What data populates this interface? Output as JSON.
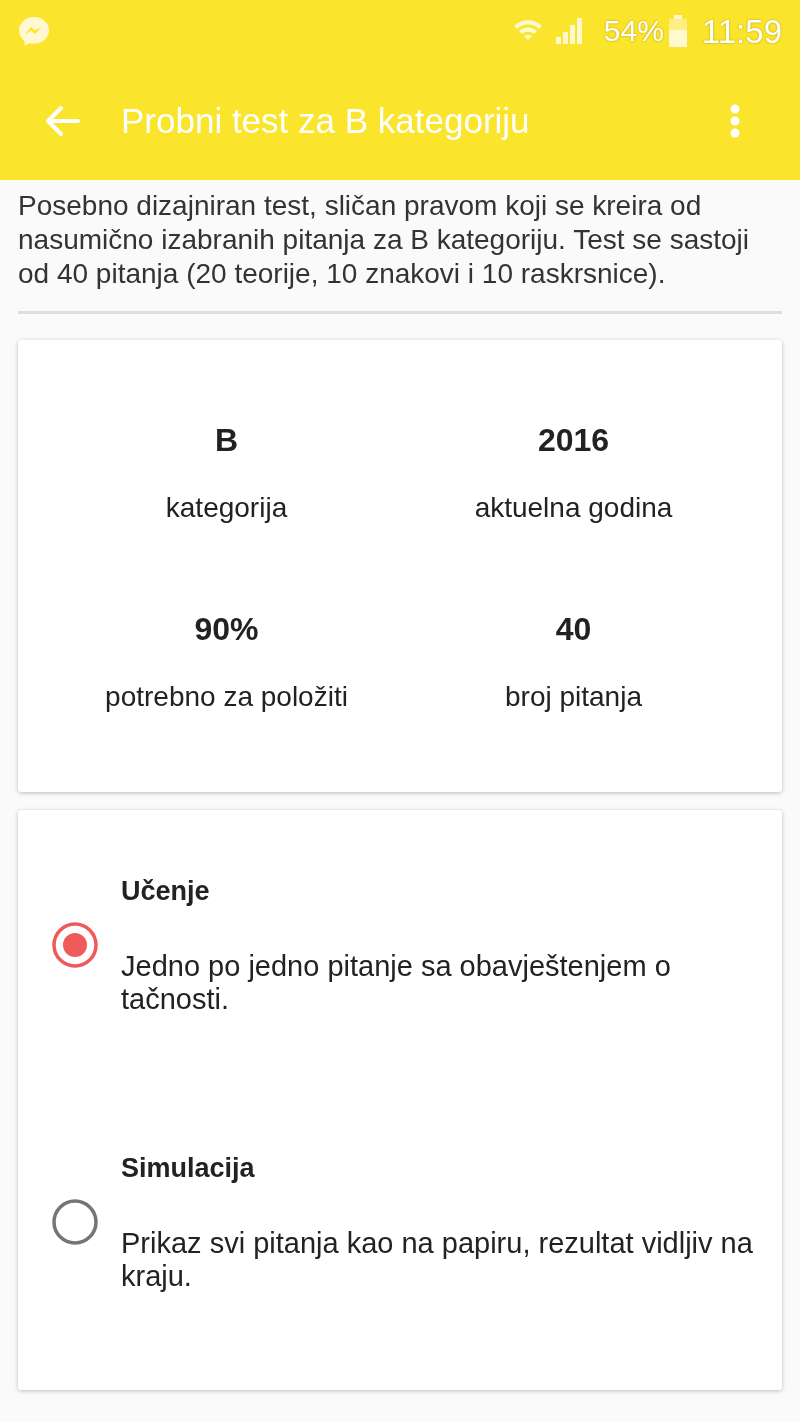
{
  "status_bar": {
    "battery": "54%",
    "time": "11:59"
  },
  "app_bar": {
    "title": "Probni test za B kategoriju"
  },
  "description": "Posebno dizajniran test, sličan pravom koji se kreira od nasumično izabranih pitanja za B kategoriju. Test se sastoji od 40 pitanja (20 teorije, 10 znakovi i 10 raskrsnice).",
  "stats": [
    {
      "value": "B",
      "label": "kategorija"
    },
    {
      "value": "2016",
      "label": "aktuelna godina"
    },
    {
      "value": "90%",
      "label": "potrebno za položiti"
    },
    {
      "value": "40",
      "label": "broj pitanja"
    }
  ],
  "modes": [
    {
      "title": "Učenje",
      "description": "Jedno po jedno pitanje sa obavještenjem o tačnosti.",
      "selected": true
    },
    {
      "title": "Simulacija",
      "description": "Prikaz svi pitanja kao na papiru, rezultat vidljiv na kraju.",
      "selected": false
    }
  ]
}
